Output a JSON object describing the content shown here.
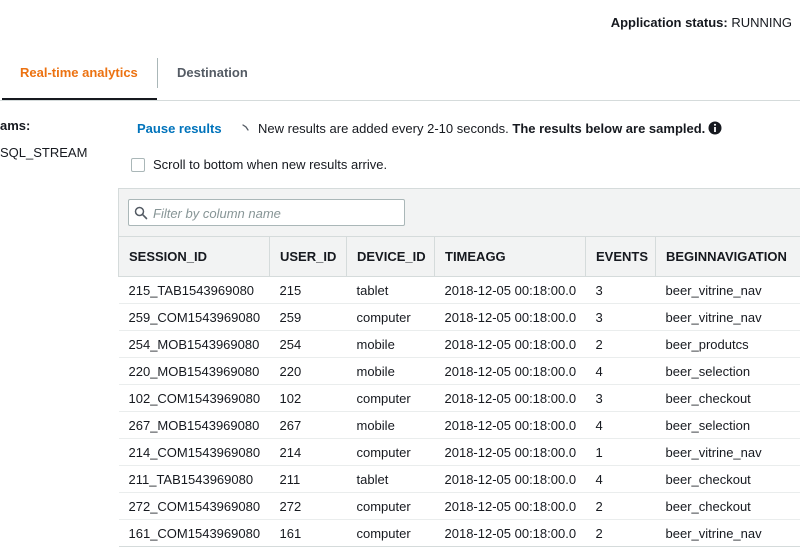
{
  "status": {
    "label": "Application status:",
    "value": "RUNNING"
  },
  "tabs": [
    {
      "label": "Real-time analytics",
      "active": true
    },
    {
      "label": "Destination",
      "active": false
    }
  ],
  "left_panel": {
    "heading": "ams:",
    "stream": "SQL_STREAM"
  },
  "controls": {
    "pause_label": "Pause results",
    "notice_text": "New results are added every 2-10 seconds.",
    "notice_bold": "The results below are sampled.",
    "scroll_label": "Scroll to bottom when new results arrive.",
    "scroll_checked": false,
    "filter_placeholder": "Filter by column name"
  },
  "colors": {
    "accent": "#ec7211",
    "link": "#0073bb",
    "header_bg": "#f2f3f3"
  },
  "icons": {
    "info": "info-icon",
    "search": "search-icon",
    "spinner": "loading-spinner-icon"
  },
  "table": {
    "columns": [
      "SESSION_ID",
      "USER_ID",
      "DEVICE_ID",
      "TIMEAGG",
      "EVENTS",
      "BEGINNAVIGATION"
    ],
    "rows": [
      [
        "215_TAB1543969080",
        "215",
        "tablet",
        "2018-12-05 00:18:00.0",
        "3",
        "beer_vitrine_nav"
      ],
      [
        "259_COM1543969080",
        "259",
        "computer",
        "2018-12-05 00:18:00.0",
        "3",
        "beer_vitrine_nav"
      ],
      [
        "254_MOB1543969080",
        "254",
        "mobile",
        "2018-12-05 00:18:00.0",
        "2",
        "beer_produtcs"
      ],
      [
        "220_MOB1543969080",
        "220",
        "mobile",
        "2018-12-05 00:18:00.0",
        "4",
        "beer_selection"
      ],
      [
        "102_COM1543969080",
        "102",
        "computer",
        "2018-12-05 00:18:00.0",
        "3",
        "beer_checkout"
      ],
      [
        "267_MOB1543969080",
        "267",
        "mobile",
        "2018-12-05 00:18:00.0",
        "4",
        "beer_selection"
      ],
      [
        "214_COM1543969080",
        "214",
        "computer",
        "2018-12-05 00:18:00.0",
        "1",
        "beer_vitrine_nav"
      ],
      [
        "211_TAB1543969080",
        "211",
        "tablet",
        "2018-12-05 00:18:00.0",
        "4",
        "beer_checkout"
      ],
      [
        "272_COM1543969080",
        "272",
        "computer",
        "2018-12-05 00:18:00.0",
        "2",
        "beer_checkout"
      ],
      [
        "161_COM1543969080",
        "161",
        "computer",
        "2018-12-05 00:18:00.0",
        "2",
        "beer_vitrine_nav"
      ]
    ]
  }
}
